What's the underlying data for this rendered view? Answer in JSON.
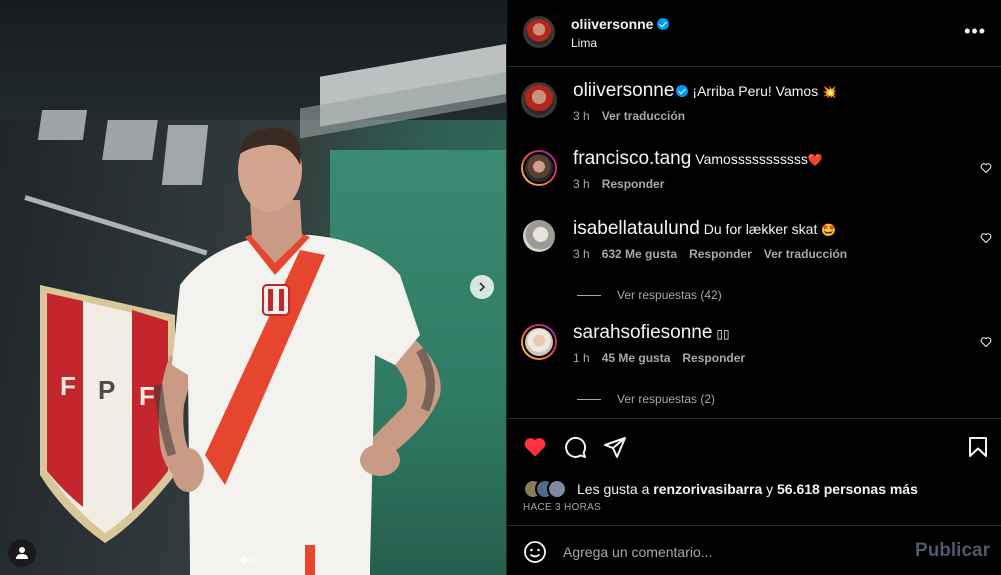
{
  "post": {
    "username": "oliiversonne",
    "location": "Lima",
    "caption": "¡Arriba Peru! Vamos",
    "caption_emoji": "💥",
    "caption_time": "3 h",
    "caption_translate": "Ver traducción"
  },
  "comments": [
    {
      "user": "francisco.tang",
      "text": "Vamosssssssssss",
      "emoji": "❤️",
      "time": "3 h",
      "actions": [
        "Responder"
      ]
    },
    {
      "user": "isabellataulund",
      "text": "Du for lækker skat",
      "emoji": "🤩",
      "time": "3 h",
      "actions": [
        "632 Me gusta",
        "Responder",
        "Ver traducción"
      ],
      "replies": "Ver respuestas (42)"
    },
    {
      "user": "sarahsofiesonne",
      "text": "",
      "emoji": "▯▯",
      "time": "1 h",
      "actions": [
        "45 Me gusta",
        "Responder"
      ],
      "replies": "Ver respuestas (2)"
    }
  ],
  "likes": {
    "prefix": "Les gusta a",
    "user": "renzorivasibarra",
    "connector": "y",
    "others": "56.618 personas más"
  },
  "time_ago": "HACE 3 HORAS",
  "comment_box": {
    "placeholder": "Agrega un comentario...",
    "publish_label": "Publicar"
  },
  "media": {
    "crest_letters": [
      "F",
      "P",
      "F"
    ],
    "carousel_total": 2,
    "carousel_active": 1
  },
  "colors": {
    "like_red": "#ff3040",
    "verified_blue": "#0095f6",
    "publish_disabled": "#4a5b6e",
    "jersey_red": "#e6462d"
  }
}
